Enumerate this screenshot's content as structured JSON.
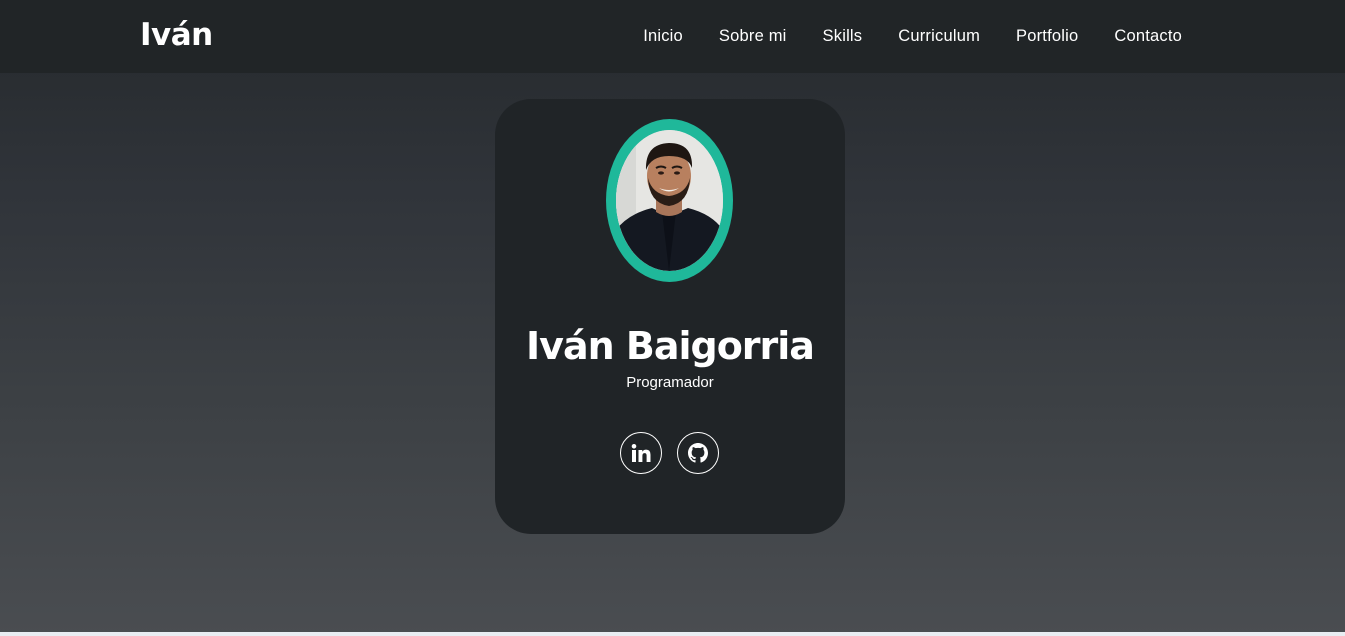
{
  "nav": {
    "brand": "Iván",
    "links": [
      {
        "label": "Inicio"
      },
      {
        "label": "Sobre mi"
      },
      {
        "label": "Skills"
      },
      {
        "label": "Curriculum"
      },
      {
        "label": "Portfolio"
      },
      {
        "label": "Contacto"
      }
    ]
  },
  "profile": {
    "name": "Iván Baigorria",
    "role": "Programador",
    "avatar_icon": "profile-photo",
    "ring_color": "#1fb89a",
    "social": [
      {
        "icon": "linkedin-icon"
      },
      {
        "icon": "github-icon"
      }
    ]
  },
  "colors": {
    "accent": "#1fb89a",
    "navbar": "#212527",
    "card": "#202427"
  }
}
